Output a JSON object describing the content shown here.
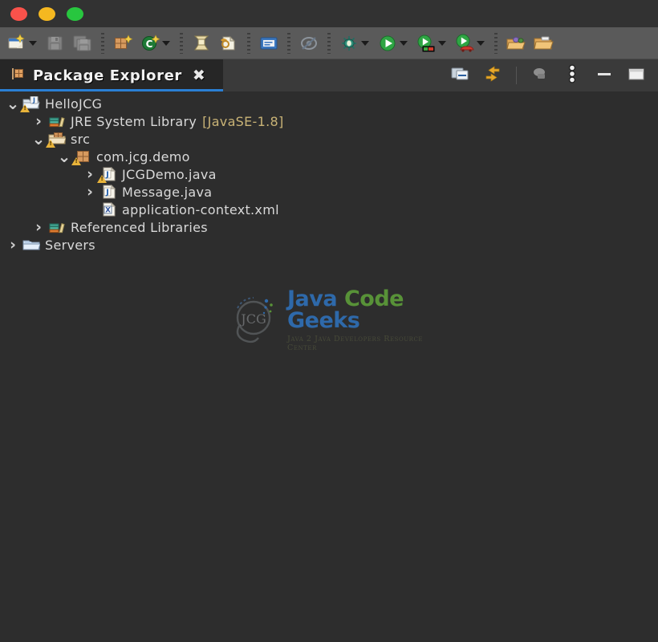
{
  "window": {
    "traffic_lights": [
      {
        "name": "close-button",
        "color": "#f9524b"
      },
      {
        "name": "minimize-button",
        "color": "#f5b820"
      },
      {
        "name": "zoom-button",
        "color": "#28c63f"
      }
    ]
  },
  "toolbar": {
    "items": [
      {
        "name": "new-wizard-button",
        "icon": "new-document-icon",
        "label": "New",
        "dropdown": true,
        "enabled": true
      },
      {
        "name": "save-button",
        "icon": "save-icon",
        "label": "Save",
        "dropdown": false,
        "enabled": false
      },
      {
        "name": "save-all-button",
        "icon": "save-all-icon",
        "label": "Save All",
        "dropdown": false,
        "enabled": false
      },
      {
        "separator": true
      },
      {
        "name": "new-java-package-button",
        "icon": "package-new-icon",
        "label": "New Java Package",
        "dropdown": false,
        "enabled": true
      },
      {
        "name": "open-type-button",
        "icon": "open-type-icon",
        "label": "Open Type",
        "dropdown": true,
        "enabled": true
      },
      {
        "separator": true
      },
      {
        "name": "build-button",
        "icon": "build-icon",
        "label": "Build",
        "dropdown": false,
        "enabled": true
      },
      {
        "name": "search-button",
        "icon": "search-resource-icon",
        "label": "Search",
        "dropdown": false,
        "enabled": true
      },
      {
        "separator": true
      },
      {
        "name": "console-button",
        "icon": "console-icon",
        "label": "Console",
        "dropdown": false,
        "enabled": true
      },
      {
        "separator": true
      },
      {
        "name": "skip-breakpoints-button",
        "icon": "skip-breakpoints-icon",
        "label": "Skip All Breakpoints",
        "dropdown": false,
        "enabled": false
      },
      {
        "separator": true
      },
      {
        "name": "debug-button",
        "icon": "debug-bug-icon",
        "label": "Debug",
        "dropdown": true,
        "enabled": true
      },
      {
        "name": "run-button",
        "icon": "run-green-play-icon",
        "label": "Run",
        "dropdown": true,
        "enabled": true
      },
      {
        "name": "run-server-button",
        "icon": "run-server-icon",
        "label": "Run on Server",
        "dropdown": true,
        "enabled": true
      },
      {
        "name": "run-stop-button",
        "icon": "run-coverage-icon",
        "label": "Coverage",
        "dropdown": true,
        "enabled": true
      },
      {
        "separator": true
      },
      {
        "name": "open-perspective-button",
        "icon": "open-perspective-icon",
        "label": "Open Perspective",
        "dropdown": false,
        "enabled": true
      },
      {
        "name": "open-resource-button",
        "icon": "open-folder-icon",
        "label": "Open Resource",
        "dropdown": false,
        "enabled": true
      }
    ]
  },
  "view": {
    "tab": {
      "icon": "package-explorer-icon",
      "title": "Package Explorer",
      "close_glyph": "✖"
    },
    "actions": [
      {
        "name": "link-with-editor-button",
        "icon": "link-editor-icon"
      },
      {
        "name": "collapse-expand-button",
        "icon": "two-arrows-icon"
      },
      {
        "separator": true
      },
      {
        "name": "focus-on-active-task-button",
        "icon": "focus-task-icon"
      },
      {
        "name": "view-menu-button",
        "icon": "vertical-dots-icon"
      },
      {
        "name": "minimize-view-button",
        "icon": "minimize-icon"
      },
      {
        "name": "maximize-view-button",
        "icon": "maximize-icon"
      }
    ]
  },
  "tree": {
    "items": [
      {
        "name": "tree-item-hellojcg",
        "label": "HelloJCG",
        "qualifier": "",
        "indent": 0,
        "arrow": "expanded",
        "icon": "java-project-icon",
        "warning": true
      },
      {
        "name": "tree-item-jre-system-library",
        "label": "JRE System Library",
        "qualifier": "[JavaSE-1.8]",
        "indent": 1,
        "arrow": "collapsed",
        "icon": "library-icon",
        "warning": false
      },
      {
        "name": "tree-item-src",
        "label": "src",
        "qualifier": "",
        "indent": 1,
        "arrow": "expanded",
        "icon": "source-folder-icon",
        "warning": true
      },
      {
        "name": "tree-item-com-jcg-demo",
        "label": "com.jcg.demo",
        "qualifier": "",
        "indent": 2,
        "arrow": "expanded",
        "icon": "package-icon",
        "warning": true
      },
      {
        "name": "tree-item-jcgdemo-java",
        "label": "JCGDemo.java",
        "qualifier": "",
        "indent": 3,
        "arrow": "collapsed",
        "icon": "java-file-icon",
        "warning": true
      },
      {
        "name": "tree-item-message-java",
        "label": "Message.java",
        "qualifier": "",
        "indent": 3,
        "arrow": "collapsed",
        "icon": "java-file-icon",
        "warning": false
      },
      {
        "name": "tree-item-application-context-xml",
        "label": "application-context.xml",
        "qualifier": "",
        "indent": 3,
        "arrow": "none",
        "icon": "xml-file-icon",
        "warning": false
      },
      {
        "name": "tree-item-referenced-libraries",
        "label": "Referenced Libraries",
        "qualifier": "",
        "indent": 1,
        "arrow": "collapsed",
        "icon": "library-icon",
        "warning": false
      },
      {
        "name": "tree-item-servers",
        "label": "Servers",
        "qualifier": "",
        "indent": 0,
        "arrow": "collapsed",
        "icon": "folder-icon",
        "warning": false
      }
    ]
  },
  "watermark": {
    "logo_text": "JCG",
    "title_parts": [
      {
        "text": "Java",
        "color_role": "blue"
      },
      {
        "text": "Code",
        "color_role": "green"
      },
      {
        "text": "Geeks",
        "color_role": "blue"
      }
    ],
    "tagline": "Java 2 Java Developers Resource Center",
    "colors": {
      "blue": "#2f6fb5",
      "green": "#5c9b3a"
    }
  }
}
